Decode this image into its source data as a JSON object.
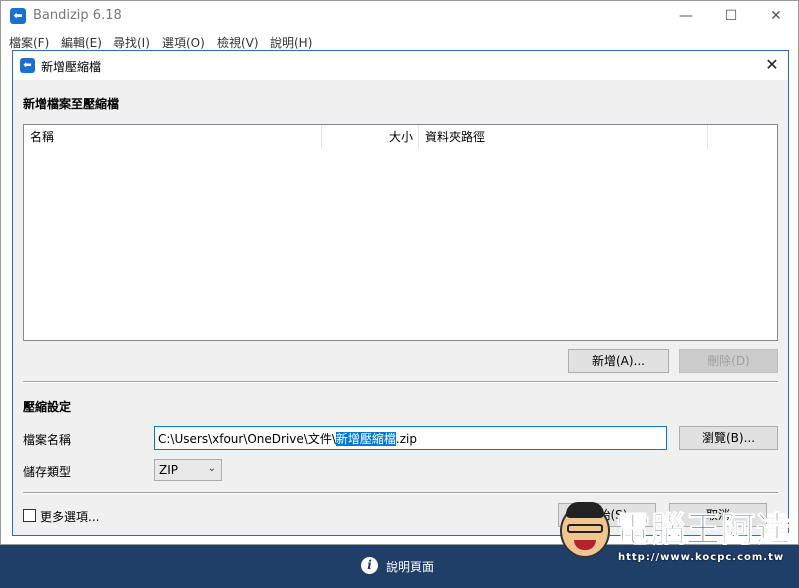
{
  "window": {
    "title": "Bandizip 6.18",
    "logo_glyph": "⬅",
    "controls": {
      "minimize": "—",
      "maximize": "☐",
      "close": "✕"
    }
  },
  "menu": [
    {
      "label": "檔案(F)"
    },
    {
      "label": "編輯(E)"
    },
    {
      "label": "尋找(I)"
    },
    {
      "label": "選項(O)"
    },
    {
      "label": "檢視(V)"
    },
    {
      "label": "說明(H)"
    }
  ],
  "dialog": {
    "title": "新增壓縮檔",
    "close": "✕",
    "add_section": {
      "title": "新增檔案至壓縮檔",
      "columns": {
        "name": "名稱",
        "size": "大小",
        "path": "資料夾路徑"
      },
      "rows": [],
      "add_button": "新增(A)...",
      "delete_button": "刪除(D)"
    },
    "settings": {
      "title": "壓縮設定",
      "filename_label": "檔案名稱",
      "filename_prefix": "C:\\Users\\xfour\\OneDrive\\文件\\",
      "filename_selected": "新增壓縮檔",
      "filename_suffix": ".zip",
      "browse_button": "瀏覽(B)...",
      "type_label": "儲存類型",
      "type_value": "ZIP"
    },
    "more_options": "更多選項...",
    "start_button": "開始(S)",
    "cancel_button": "取消"
  },
  "statusbar": {
    "help": "說明頁面"
  },
  "watermark": {
    "text": "電腦王阿達",
    "url": "http://www.kocpc.com.tw"
  },
  "colors": {
    "accent": "#0078d7",
    "statusbar": "#1f3f69"
  }
}
